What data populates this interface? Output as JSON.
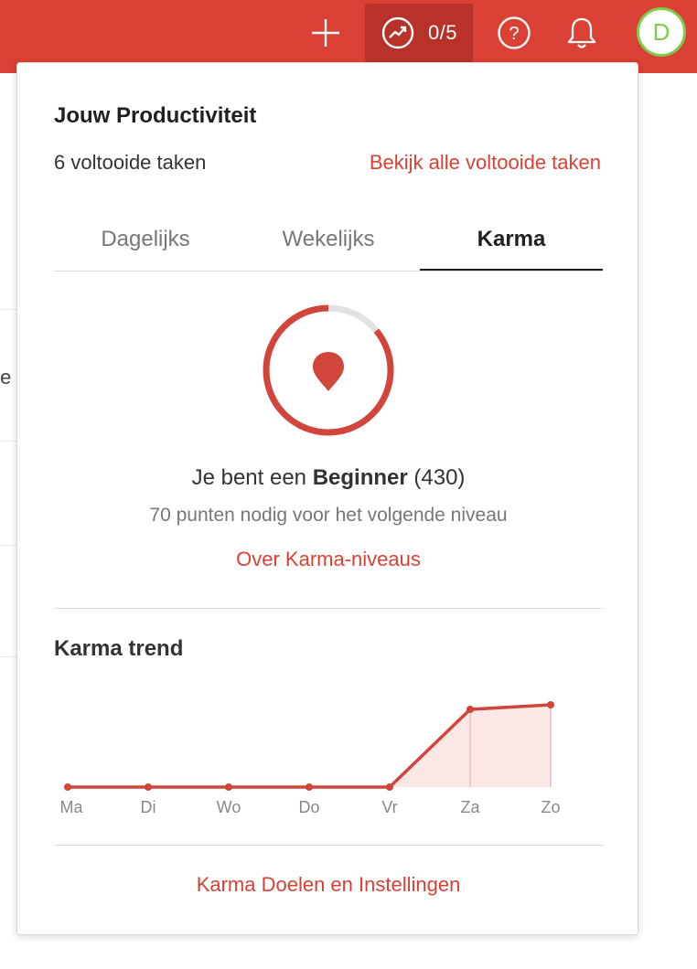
{
  "topbar": {
    "productivity_count": "0/5",
    "avatar_initial": "D",
    "colors": {
      "bar": "#db4035",
      "avatar_ring": "#7ecc49"
    }
  },
  "background": {
    "fragment_text": "te"
  },
  "popup": {
    "title": "Jouw Productiviteit",
    "completed_count": "6 voltooide taken",
    "view_all_link": "Bekijk alle voltooide taken",
    "tabs": [
      {
        "label": "Dagelijks",
        "active": false
      },
      {
        "label": "Wekelijks",
        "active": false
      },
      {
        "label": "Karma",
        "active": true
      }
    ],
    "karma": {
      "status_prefix": "Je bent een",
      "level": "Beginner",
      "score": "(430)",
      "points_needed": "70 punten nodig voor het volgende niveau",
      "about_link": "Over Karma-niveaus",
      "progress_fraction": 0.86
    },
    "trend_title": "Karma trend",
    "footer_link": "Karma Doelen en Instellingen"
  },
  "chart_data": {
    "type": "area",
    "categories": [
      "Ma",
      "Di",
      "Wo",
      "Do",
      "Vr",
      "Za",
      "Zo"
    ],
    "values": [
      0,
      0,
      0,
      0,
      0,
      85,
      90
    ],
    "ylim": [
      0,
      100
    ],
    "grid": false,
    "colors": {
      "line": "#d1453b",
      "fill": "#fbe8e6",
      "vline": "#e4cfcd"
    }
  }
}
